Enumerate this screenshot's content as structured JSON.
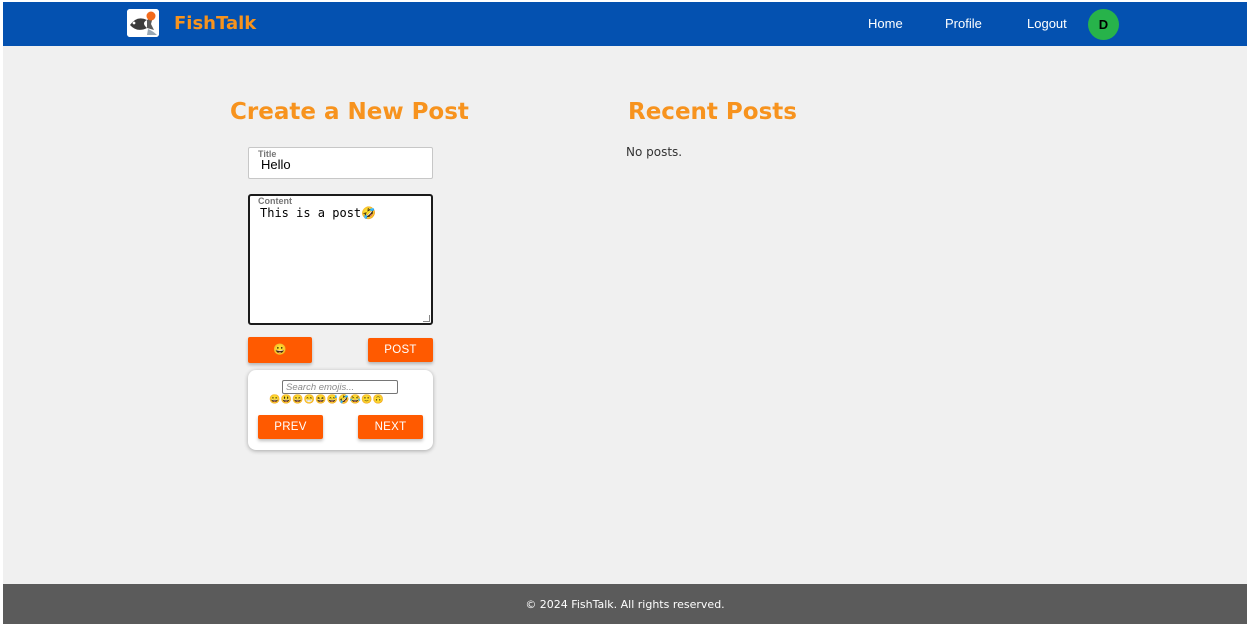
{
  "header": {
    "brand": "FishTalk",
    "nav": {
      "home": "Home",
      "profile": "Profile",
      "logout": "Logout"
    },
    "avatar_initial": "D"
  },
  "create": {
    "heading": "Create a New Post",
    "title_label": "Title",
    "title_value": "Hello",
    "content_label": "Content",
    "content_value": "This is a post🤣",
    "emoji_button": "😀",
    "post_button": "POST"
  },
  "picker": {
    "search_placeholder": "Search emojis...",
    "emojis": [
      "😀",
      "😃",
      "😄",
      "😁",
      "😆",
      "😅",
      "🤣",
      "😂",
      "🙂",
      "🙃"
    ],
    "prev": "PREV",
    "next": "NEXT"
  },
  "recent": {
    "heading": "Recent Posts",
    "empty": "No posts."
  },
  "footer": {
    "text": "© 2024 FishTalk. All rights reserved."
  },
  "colors": {
    "header_bg": "#0451b0",
    "brand": "#f7931e",
    "button": "#ff5a00",
    "avatar": "#27b34a",
    "footer_bg": "#5b5b5b",
    "page_bg": "#f0f0f0"
  }
}
